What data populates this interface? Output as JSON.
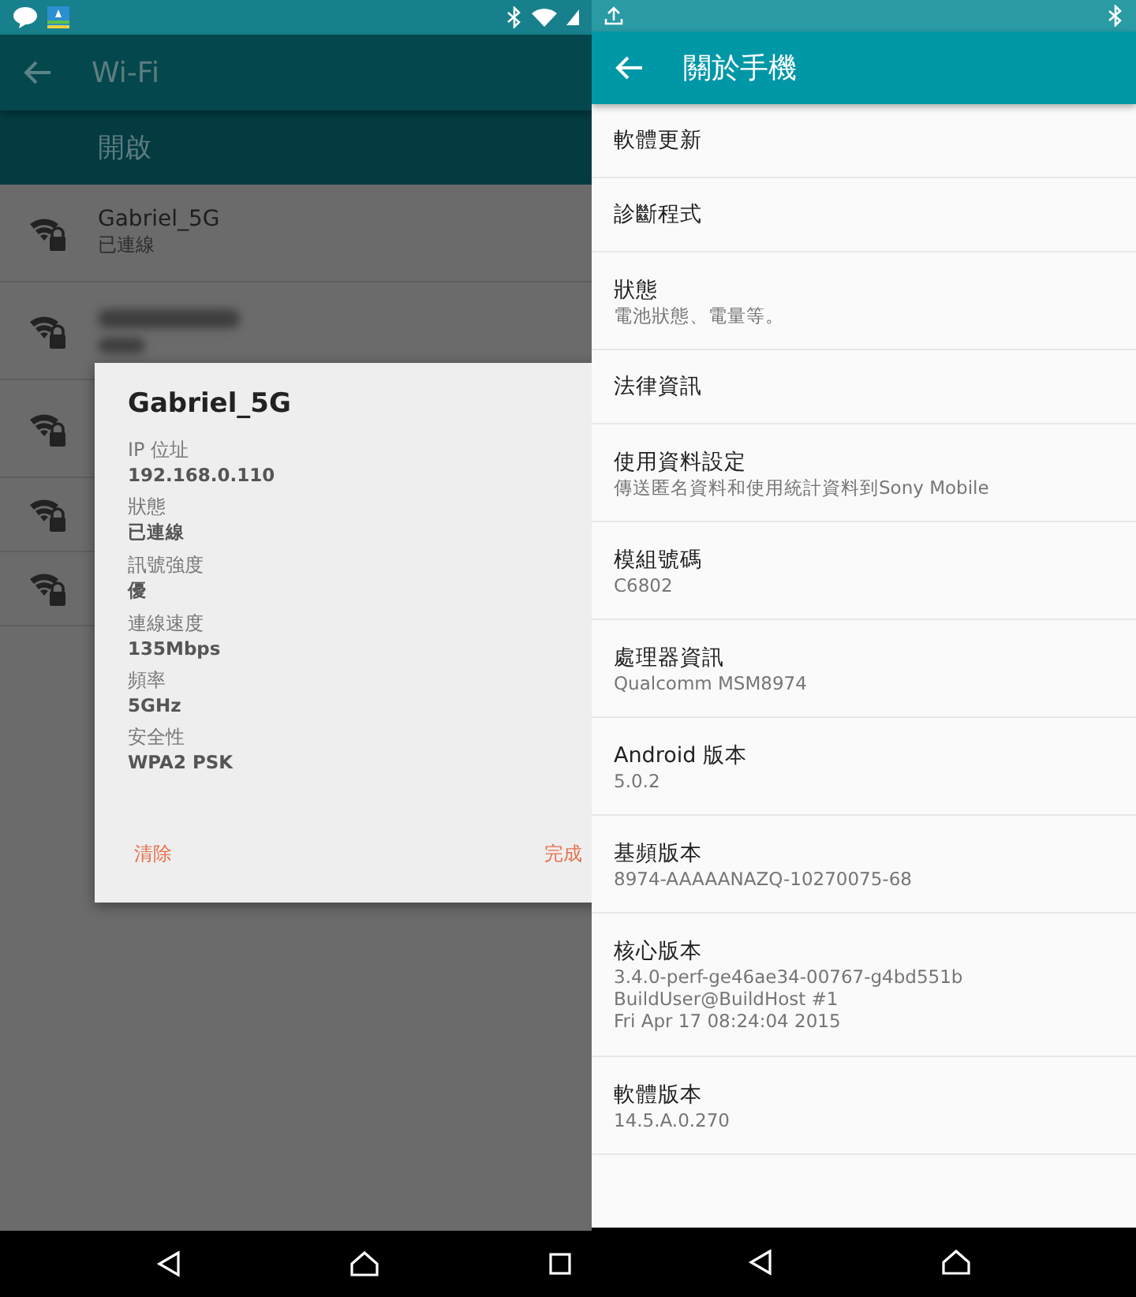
{
  "left": {
    "app_bar": {
      "title": "Wi-Fi"
    },
    "switch_label": "開啟",
    "networks": [
      {
        "kind": "named",
        "name": "Gabriel_5G",
        "status": "已連線"
      },
      {
        "kind": "blurred"
      },
      {
        "kind": "plain"
      },
      {
        "kind": "compact"
      },
      {
        "kind": "compact"
      }
    ],
    "dialog": {
      "title": "Gabriel_5G",
      "fields": [
        {
          "label": "IP 位址",
          "value": "192.168.0.110"
        },
        {
          "label": "狀態",
          "value": "已連線"
        },
        {
          "label": "訊號強度",
          "value": "優"
        },
        {
          "label": "連線速度",
          "value": "135Mbps"
        },
        {
          "label": "頻率",
          "value": "5GHz"
        },
        {
          "label": "安全性",
          "value": "WPA2 PSK"
        }
      ],
      "buttons": [
        "清除",
        "完成"
      ]
    }
  },
  "right": {
    "app_bar": {
      "title": "關於手機"
    },
    "items": [
      {
        "title": "軟體更新"
      },
      {
        "title": "診斷程式"
      },
      {
        "title": "狀態",
        "details": [
          "電池狀態、電量等。"
        ]
      },
      {
        "title": "法律資訊"
      },
      {
        "title": "使用資料設定",
        "details": [
          "傳送匿名資料和使用統計資料到Sony Mobile"
        ]
      },
      {
        "title": "模組號碼",
        "details": [
          "C6802"
        ]
      },
      {
        "title": "處理器資訊",
        "details": [
          "Qualcomm MSM8974"
        ]
      },
      {
        "title": "Android 版本",
        "details": [
          "5.0.2"
        ]
      },
      {
        "title": "基頻版本",
        "details": [
          "8974-AAAAANAZQ-10270075-68"
        ]
      },
      {
        "title": "核心版本",
        "details": [
          "3.4.0-perf-ge46ae34-00767-g4bd551b",
          "BuildUser@BuildHost #1",
          "Fri Apr 17 08:24:04 2015"
        ]
      },
      {
        "title": "軟體版本",
        "details": [
          "14.5.A.0.270"
        ]
      }
    ]
  }
}
